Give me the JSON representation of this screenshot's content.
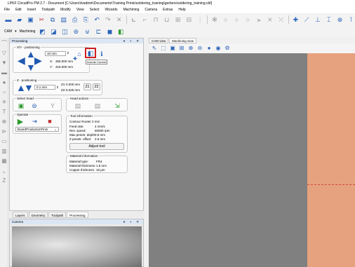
{
  "window": {
    "title": "LPKF CircuitPro PM 2.7 - Document [C:\\Users\\tvadmin\\Documents\\Training Prints\\soldering_training\\gerbers\\soldering_training.cbf]"
  },
  "menu": [
    "File",
    "Edit",
    "Insert",
    "Toolpath",
    "Modify",
    "View",
    "Select",
    "Wizards",
    "Machining",
    "Camera",
    "Extras",
    "Help"
  ],
  "toolbar2": {
    "cam_label": "CAM",
    "machining_label": "Machining"
  },
  "panel": {
    "title": "Processing"
  },
  "xy": {
    "group_title": "X/Y - positioning",
    "step_value": "10 mm",
    "x_label": "X:",
    "x_value": "355.000 mm",
    "y_label": "Y:",
    "y_value": "318.000 mm",
    "tooltip": "Include Current"
  },
  "z": {
    "group_title": "Z - positioning",
    "step_value": "0.1 mm",
    "z1_label": "Z1:",
    "z1_value": "0.000 mm",
    "z2_label": "Z2:",
    "z2_value": "5.025 mm",
    "z1_button": "Z1",
    "z2_button": "Z2"
  },
  "select_head": {
    "group_title": "Select head"
  },
  "head_actions": {
    "group_title": "Head actions"
  },
  "operate": {
    "group_title": "Operate",
    "dropdown_value": "BoardProductionFinis"
  },
  "tool_info": {
    "group_title": "Tool information",
    "tool_name": "Contour Router 2 mm",
    "rows": [
      {
        "label": "Feed rate:",
        "value": "4 mm/s"
      },
      {
        "label": "Rev. speed:",
        "value": "60000 rpm"
      },
      {
        "label": "Max penetr. depth:",
        "value": "0.5 mm"
      },
      {
        "label": "Z penetr. offset:",
        "value": "2.6 mm"
      }
    ],
    "adjust_button": "Adjust tool"
  },
  "material_info": {
    "group_title": "Material information",
    "rows": [
      {
        "label": "Material type:",
        "value": "FR4"
      },
      {
        "label": "Material thickness:",
        "value": "1.5 mm"
      },
      {
        "label": "Copper thickness:",
        "value": "18 µm"
      }
    ]
  },
  "bottom_tabs": [
    "Layers",
    "Geometry",
    "Toolpath",
    "Processing"
  ],
  "camera": {
    "title": "Camera"
  },
  "view_tabs": [
    "CAM view",
    "Machining view"
  ],
  "colors": {
    "board": "#e6a27f",
    "canvas": "#808080",
    "accent": "#2a63b8",
    "highlight": "#d02020"
  }
}
